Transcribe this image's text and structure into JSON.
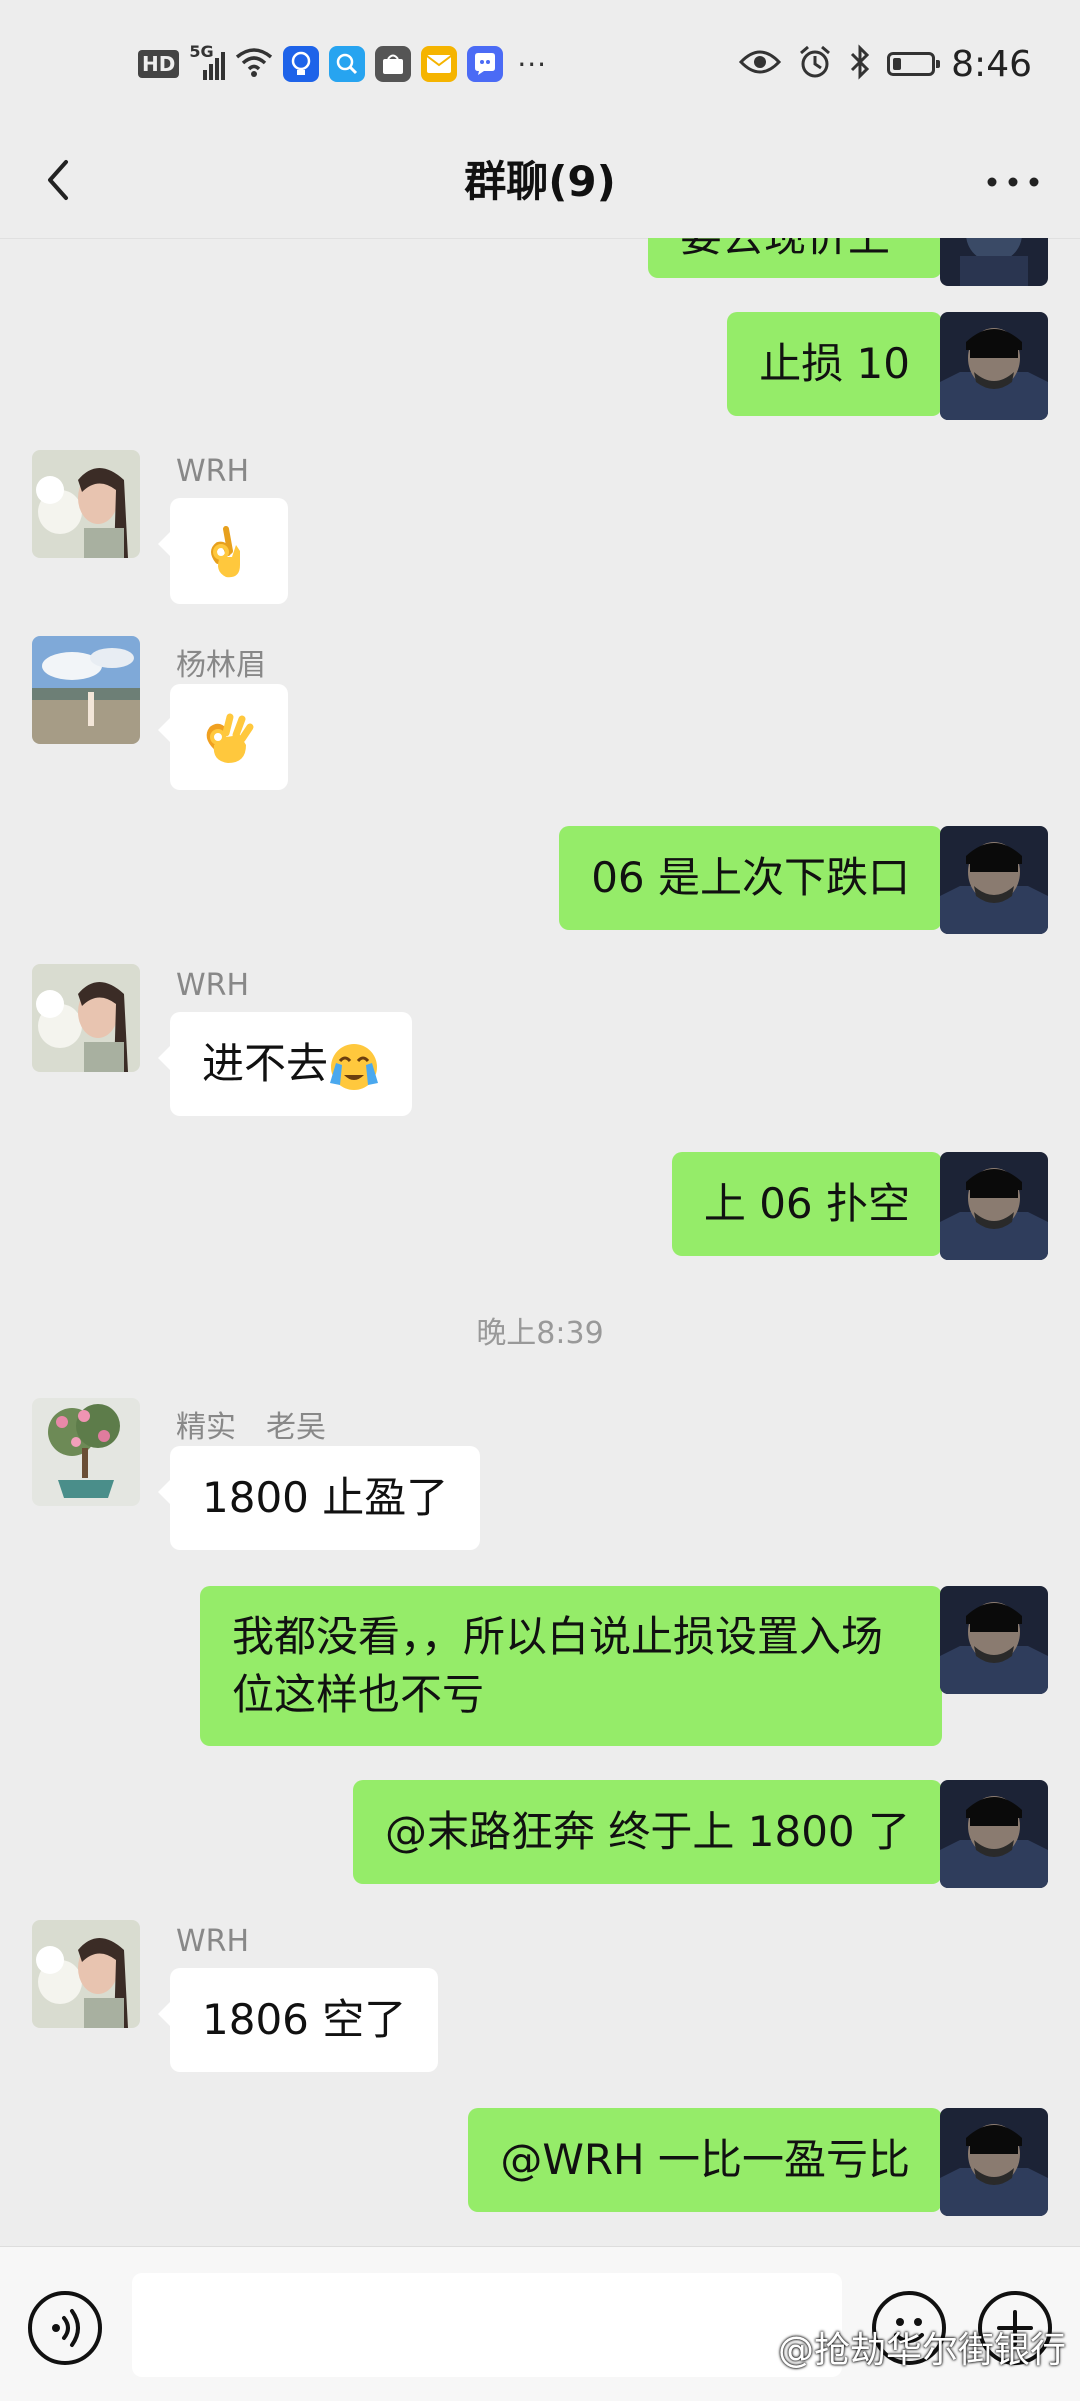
{
  "status_bar": {
    "hd": "HD",
    "network": "5G",
    "time": "8:46",
    "more": "···"
  },
  "header": {
    "title": "群聊(9)"
  },
  "messages": [
    {
      "side": "right",
      "text": "要去现价上"
    },
    {
      "side": "right",
      "text": "止损 10"
    },
    {
      "side": "left",
      "sender": "WRH",
      "emoji": "ok-hand"
    },
    {
      "side": "left",
      "sender": "杨林眉",
      "emoji": "ok-hand"
    },
    {
      "side": "right",
      "text": "06 是上次下跌口"
    },
    {
      "side": "left",
      "sender": "WRH",
      "text": "进不去",
      "emoji": "crying-face"
    },
    {
      "side": "right",
      "text": "上 06 扑空"
    },
    {
      "timestamp": "晚上8:39"
    },
    {
      "side": "left",
      "sender": "精实　老吴",
      "text": "1800 止盈了"
    },
    {
      "side": "right",
      "text": "我都没看，，所以白说止损设置入场位这样也不亏"
    },
    {
      "side": "right",
      "text": "@末路狂奔  终于上 1800 了"
    },
    {
      "side": "left",
      "sender": "WRH",
      "text": "1806 空了"
    },
    {
      "side": "right",
      "text": "@WRH  一比一盈亏比"
    }
  ],
  "watermark": "@抢劫华尔街银行",
  "colors": {
    "background": "#ededed",
    "my_bubble": "#95ec69",
    "their_bubble": "#ffffff"
  }
}
